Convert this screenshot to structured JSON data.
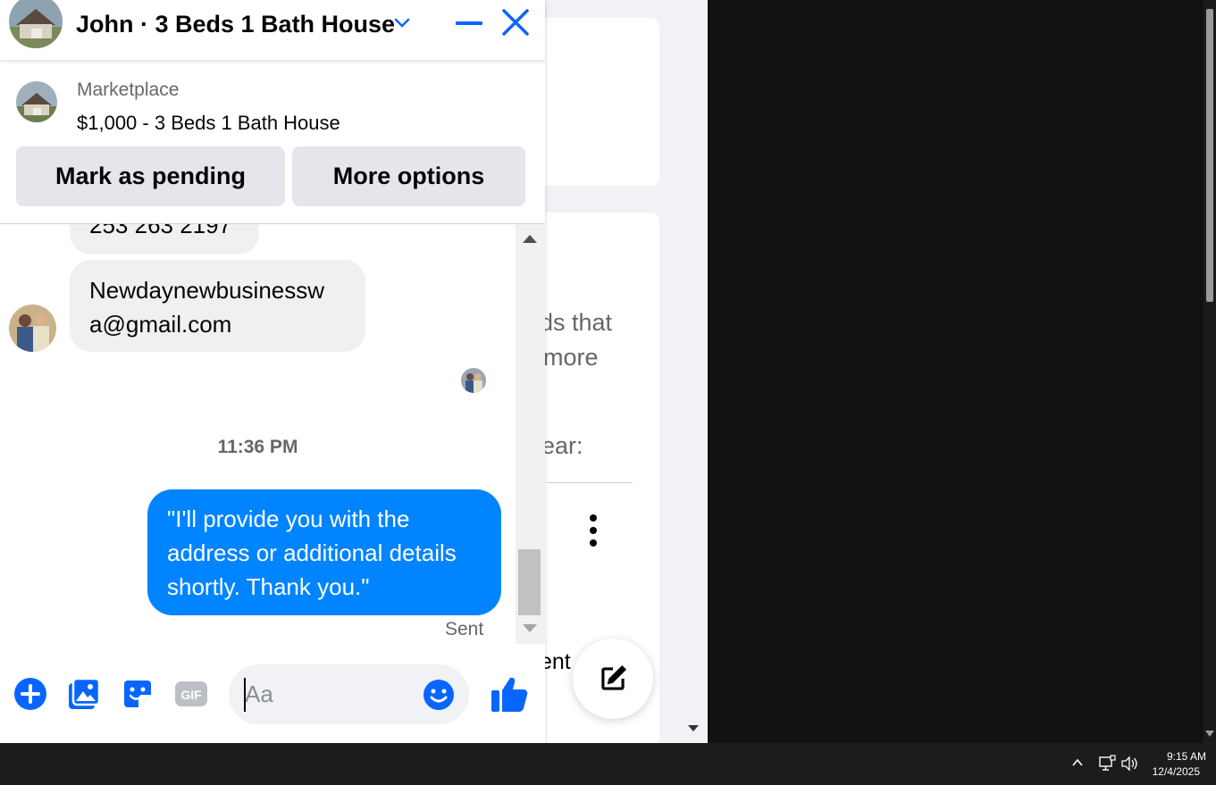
{
  "header": {
    "title": "John · 3 Beds 1 Bath House"
  },
  "listing": {
    "source": "Marketplace",
    "title": "$1,000 - 3 Beds 1 Bath House",
    "pending_label": "Mark as pending",
    "more_label": "More options"
  },
  "messages": {
    "phone_partial": "253 263 2197",
    "email_line1": "Newdaynewbusinessw",
    "email_line2": "a@gmail.com",
    "time": "11:36 PM",
    "outgoing": "\"I'll provide you with the address or additional details shortly. Thank you.\"",
    "status": "Sent"
  },
  "composer": {
    "placeholder": "Aa",
    "gif_label": "GIF"
  },
  "background_page": {
    "text_1": "ds that",
    "text_2": "more",
    "text_3": "ear:",
    "text_4": "ent"
  },
  "taskbar": {
    "time": "9:15 AM",
    "date": "12/4/2025"
  },
  "colors": {
    "accent": "#0084ff",
    "messenger_blue": "#0866ff",
    "bubble_gray": "#f0f0f0",
    "taskbar": "#1c1c1c"
  }
}
